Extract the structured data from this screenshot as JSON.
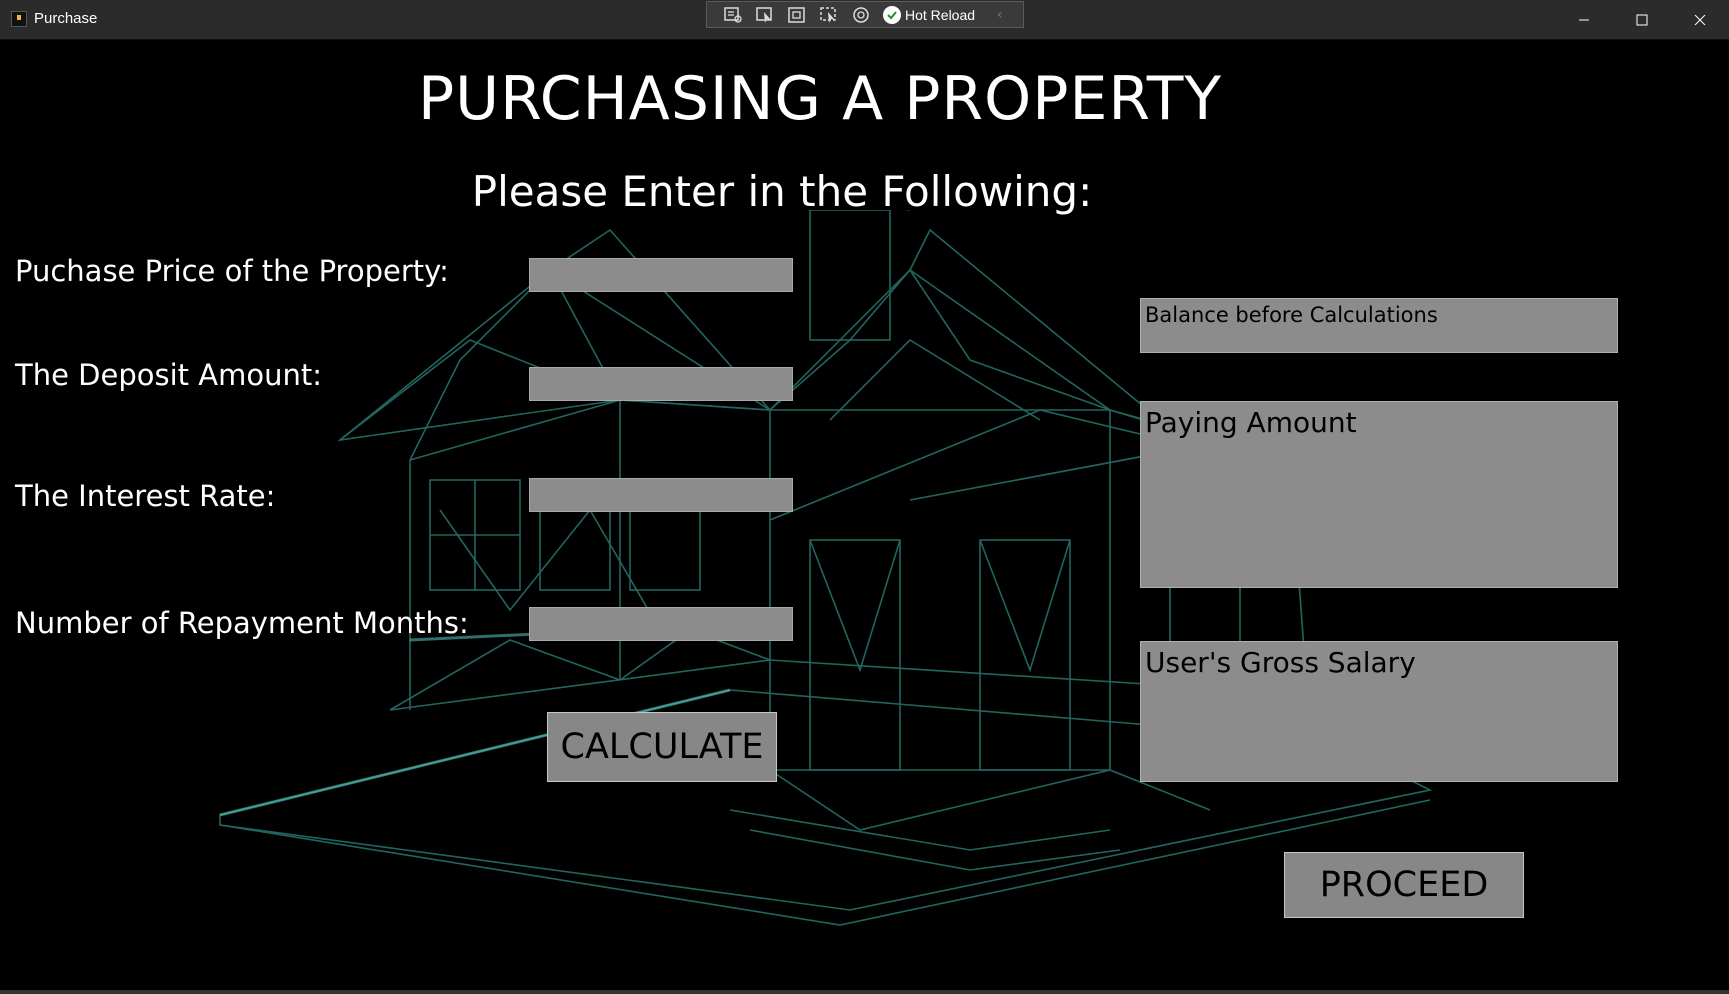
{
  "window": {
    "title": "Purchase",
    "controls": {
      "minimize": "minimize-icon",
      "maximize": "maximize-icon",
      "close": "close-icon"
    }
  },
  "dev_toolbar": {
    "hot_reload_label": "Hot Reload",
    "icons": [
      "live-visual-tree-icon",
      "select-element-icon",
      "display-adorners-icon",
      "track-focus-icon",
      "hot-reload-settings-icon",
      "check-icon",
      "chevron-left-icon"
    ]
  },
  "header": {
    "title": "PURCHASING A PROPERTY",
    "subtitle": "Please Enter in the Following:"
  },
  "form": {
    "purchase_price": {
      "label": "Puchase Price of the Property:",
      "value": ""
    },
    "deposit": {
      "label": "The Deposit Amount:",
      "value": ""
    },
    "interest_rate": {
      "label": "The Interest Rate:",
      "value": ""
    },
    "repayment_months": {
      "label": "Number of Repayment Months:",
      "value": ""
    }
  },
  "outputs": {
    "balance": "Balance before Calculations",
    "paying_amount": "Paying Amount",
    "gross_salary": "User's Gross Salary"
  },
  "buttons": {
    "calculate": "CALCULATE",
    "proceed": "PROCEED"
  },
  "theme": {
    "background": "#000000",
    "field_fill": "#8c8c8c",
    "wireframe": "#3fb8b0"
  }
}
